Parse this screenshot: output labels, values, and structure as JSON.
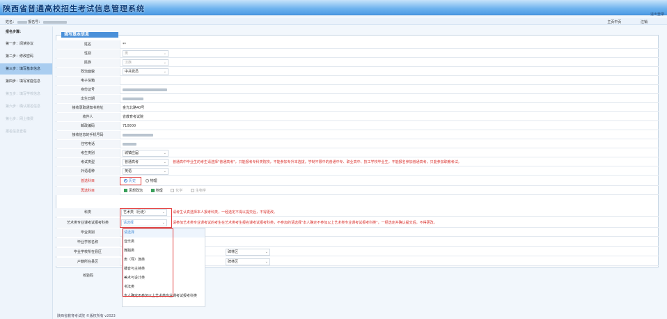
{
  "window": {
    "title": "陕西省普通高校招生考试信息管理系统",
    "logout": "退出登录"
  },
  "infobar": {
    "name_label": "姓名：",
    "reg_label": "报名号：",
    "links": [
      "主页中页",
      "注销"
    ]
  },
  "sidebar": {
    "title": "报名步骤:",
    "steps": [
      {
        "label": "第一步：阅读协议",
        "state": "normal"
      },
      {
        "label": "第二步：修改密码",
        "state": "normal"
      },
      {
        "label": "第三步：填写基本信息",
        "state": "active"
      },
      {
        "label": "第四步：填写家庭信息",
        "state": "normal"
      },
      {
        "label": "第五步：填写学校信息",
        "state": "disabled"
      },
      {
        "label": "第六步：确认报名信息",
        "state": "disabled"
      },
      {
        "label": "第七步：网上缴费",
        "state": "disabled"
      },
      {
        "label": "报名信息查看",
        "state": "disabled"
      }
    ]
  },
  "form": {
    "section_title": "填写基本信息",
    "fields": {
      "name": {
        "label": "姓名",
        "value": "**"
      },
      "gender": {
        "label": "性别",
        "value": "男"
      },
      "ethnicity": {
        "label": "民族",
        "value": "汉族"
      },
      "political": {
        "label": "政治面貌",
        "value": "中共党员"
      },
      "email": {
        "label": "电子信箱",
        "value": ""
      },
      "idcard": {
        "label": "身份证号",
        "value": ""
      },
      "birthday": {
        "label": "出生日期",
        "value": ""
      },
      "mail_address": {
        "label": "接收录取通知书地址",
        "value": "金光北路40号"
      },
      "recipient": {
        "label": "收件人",
        "value": "省教育考试院"
      },
      "postcode": {
        "label": "邮政编码",
        "value": "710000"
      },
      "mobile": {
        "label": "接收信息的手机号码",
        "value": ""
      },
      "phone": {
        "label": "住宅电话",
        "value": ""
      },
      "exam_category": {
        "label": "考生类别",
        "value": "城镇应届"
      },
      "exam_type": {
        "label": "考试类型",
        "value": "普通高考",
        "note": "普通高中毕业生的考生请选择\"普通高考\"，只能报考专科类院校，不能参加专升本选拔，学制不限中的普通中专、职业高中、技工学校毕业生，不能报名参加普通高考，只能参加职教考试。"
      },
      "foreign_lang": {
        "label": "外语语种",
        "value": "英语"
      },
      "first_subject": {
        "label": "首选科目",
        "options": [
          "历史",
          "物理"
        ],
        "selected": 0
      },
      "second_subject": {
        "label": "再选科目",
        "options": [
          "思想政治",
          "地理",
          "化学",
          "生物学"
        ],
        "checked": [
          true,
          true,
          false,
          false
        ]
      },
      "subject_type": {
        "label": "科类",
        "value": "艺术类（历史）",
        "note": "请考生认真选择本人报考科类，一经选定不得以提交后，不得更改。"
      },
      "art_category": {
        "label": "艺术类专业课考试报考科类",
        "value": "请选择",
        "note": "请参加艺术类专业课考试的考生在艺术类考生报名课考试报考科类，不参加的请选择\"本人确定不参加以上艺术类专业课考试报考科类\"，一经选定并确认提交后，不得更改。"
      },
      "grad_school": {
        "label": "毕业类别",
        "value": ""
      },
      "school_code": {
        "label": "毕业学校名称",
        "value": ""
      },
      "school_region": {
        "label": "毕业学校所在县区",
        "value": "",
        "right": "碑林区"
      },
      "household_region": {
        "label": "户籍所在县区",
        "value": "",
        "right": "碑林区"
      },
      "captcha": {
        "label": "校验码",
        "value": ""
      }
    }
  },
  "dropdown": {
    "items": [
      "请选择",
      "音乐类",
      "舞蹈类",
      "表（导）演类",
      "播音与主持类",
      "美术与设计类",
      "书法类",
      "本人确定不参加以上艺术类专业课考试报考科类"
    ]
  },
  "footer": "陕西省教育考试院 ©版权所有 v2023",
  "colors": {
    "accent": "#4a90d9",
    "highlight": "#e23b3b",
    "note": "#d9302c"
  }
}
